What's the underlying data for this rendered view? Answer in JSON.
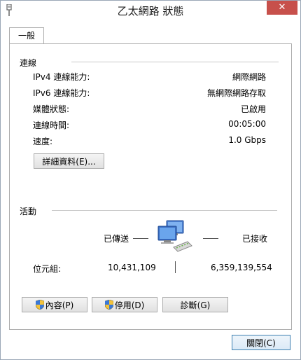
{
  "window": {
    "title": "乙太網路 狀態",
    "close_glyph": "✕"
  },
  "tabs": [
    {
      "label": "一般"
    }
  ],
  "connection": {
    "group_title": "連線",
    "rows": [
      {
        "label": "IPv4 連線能力:",
        "value": "網際網路"
      },
      {
        "label": "IPv6 連線能力:",
        "value": "無網際網路存取"
      },
      {
        "label": "媒體狀態:",
        "value": "已啟用"
      },
      {
        "label": "連線時間:",
        "value": "00:05:00"
      },
      {
        "label": "速度:",
        "value": "1.0 Gbps"
      }
    ],
    "details_button": "詳細資料(E)..."
  },
  "activity": {
    "group_title": "活動",
    "sent_label": "已傳送",
    "received_label": "已接收",
    "bytes_label": "位元組:",
    "bytes_sent": "10,431,109",
    "bytes_received": "6,359,139,554",
    "icon": "network-computers-icon"
  },
  "buttons": {
    "properties": "內容(P)",
    "disable": "停用(D)",
    "diagnose": "診斷(G)",
    "close": "關閉(C)"
  },
  "colors": {
    "close_button": "#c7504b",
    "focus_border": "#3c7fb1"
  }
}
